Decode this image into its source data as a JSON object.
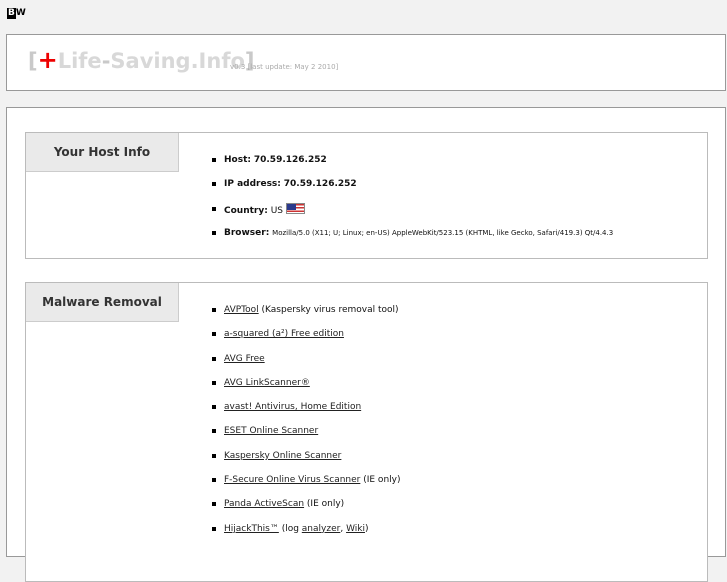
{
  "badge": {
    "b": "B",
    "w": "W"
  },
  "header": {
    "logo": {
      "open": "[",
      "plus": "+",
      "part1": "Life",
      "sep": "-",
      "part2": "Saving.Info",
      "close": "]"
    },
    "version": "v0.3 [last update: May 2 2010]"
  },
  "host_info": {
    "title": "Your Host Info",
    "host": {
      "label": "Host:",
      "value": "70.59.126.252"
    },
    "ip": {
      "label": "IP address:",
      "value": "70.59.126.252"
    },
    "country": {
      "label": "Country:",
      "value": "US",
      "flag_icon": "us-flag-icon"
    },
    "browser": {
      "label": "Browser:",
      "value": "Mozilla/5.0 (X11; U; Linux; en-US) AppleWebKit/523.15 (KHTML, like Gecko, Safari/419.3) Qt/4.4.3"
    }
  },
  "malware": {
    "title": "Malware Removal",
    "items": [
      {
        "link": "AVPTool",
        "suffix": " (Kaspersky virus removal tool)"
      },
      {
        "link": "a-squared (a²) Free edition",
        "suffix": ""
      },
      {
        "link": "AVG Free",
        "suffix": ""
      },
      {
        "link": "AVG LinkScanner®",
        "suffix": ""
      },
      {
        "link": "avast! Antivirus, Home Edition",
        "suffix": ""
      },
      {
        "link": "ESET Online Scanner",
        "suffix": ""
      },
      {
        "link": "Kaspersky Online Scanner",
        "suffix": ""
      },
      {
        "link": "F-Secure Online Virus Scanner",
        "suffix": " (IE only)"
      },
      {
        "link": "Panda ActiveScan",
        "suffix": " (IE only)"
      }
    ],
    "hijack": {
      "link": "HijackThis™",
      "pre": " (log ",
      "link2": "analyzer",
      "mid": ", ",
      "link3": "Wiki",
      "post": ")"
    }
  }
}
